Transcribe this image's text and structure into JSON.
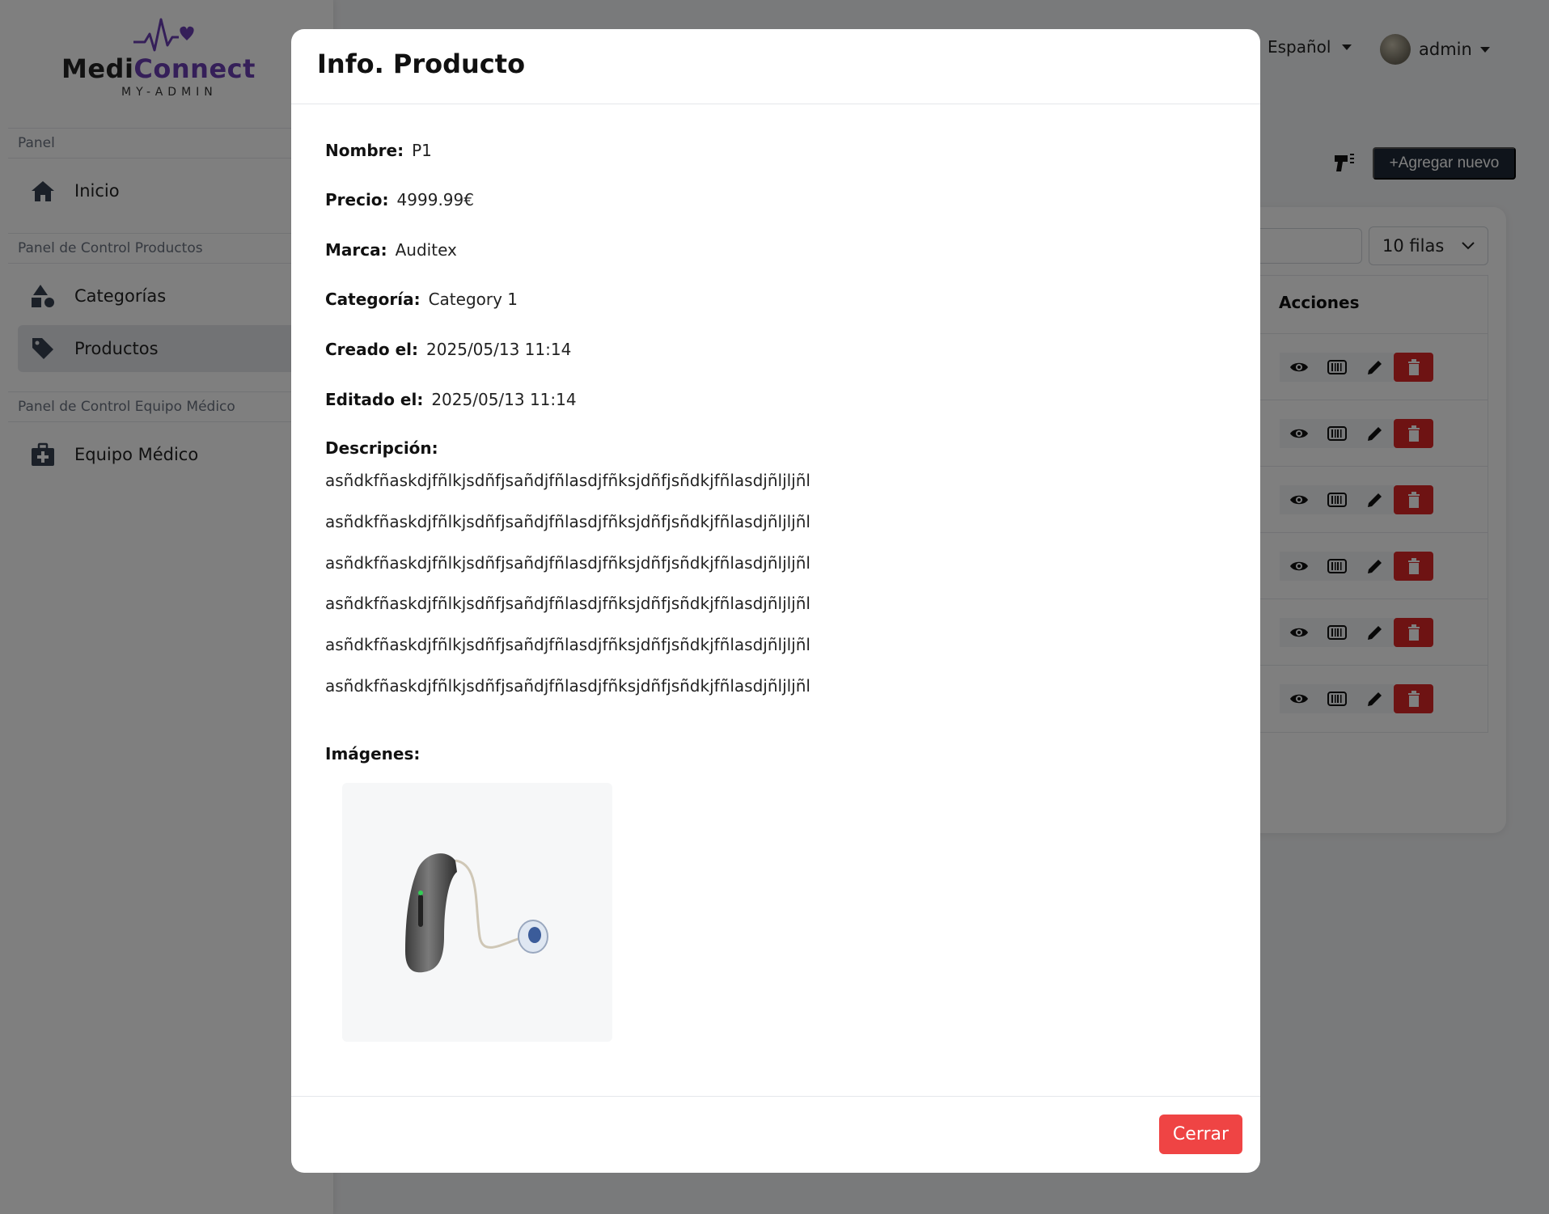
{
  "app": {
    "logo": {
      "part1": "Medi",
      "part2": "Connect",
      "subtitle": "MY-ADMIN"
    }
  },
  "sidebar": {
    "sections": [
      {
        "label": "Panel"
      },
      {
        "label": "Panel de Control Productos"
      },
      {
        "label": "Panel de Control Equipo Médico"
      }
    ],
    "items": [
      {
        "label": "Inicio",
        "icon": "home-icon"
      },
      {
        "label": "Categorías",
        "icon": "shapes-icon"
      },
      {
        "label": "Productos",
        "icon": "tag-icon",
        "active": true
      },
      {
        "label": "Equipo Médico",
        "icon": "medical-kit-icon"
      }
    ]
  },
  "topbar": {
    "language": "Español",
    "user": "admin"
  },
  "toolbar": {
    "add_label": "+Agregar nuevo"
  },
  "table": {
    "rows_select": "10 filas",
    "actions_header": "Acciones",
    "row_count": 6
  },
  "modal": {
    "title": "Info. Producto",
    "fields": {
      "name_label": "Nombre:",
      "name": "P1",
      "price_label": "Precio:",
      "price": "4999.99€",
      "brand_label": "Marca:",
      "brand": "Auditex",
      "category_label": "Categoría:",
      "category": "Category 1",
      "created_label": "Creado el:",
      "created": "2025/05/13 11:14",
      "edited_label": "Editado el:",
      "edited": "2025/05/13 11:14"
    },
    "description_label": "Descripción:",
    "description_lines": [
      "asñdkfñaskdjfñlkjsdñfjsañdjfñlasdjfñksjdñfjsñdkjfñlasdjñljljñl",
      "asñdkfñaskdjfñlkjsdñfjsañdjfñlasdjfñksjdñfjsñdkjfñlasdjñljljñl",
      "asñdkfñaskdjfñlkjsdñfjsañdjfñlasdjfñksjdñfjsñdkjfñlasdjñljljñl",
      "asñdkfñaskdjfñlkjsdñfjsañdjfñlasdjfñksjdñfjsñdkjfñlasdjñljljñl",
      "asñdkfñaskdjfñlkjsdñfjsañdjfñlasdjfñksjdñfjsñdkjfñlasdjñljljñl",
      "asñdkfñaskdjfñlkjsdñfjsañdjfñlasdjfñksjdñfjsñdkjfñlasdjñljljñl"
    ],
    "images_label": "Imágenes:",
    "close_label": "Cerrar"
  },
  "colors": {
    "brand_purple": "#6b3fb3",
    "danger": "#dc2626",
    "close_button": "#ef4444",
    "dark_button": "#1f2937"
  }
}
